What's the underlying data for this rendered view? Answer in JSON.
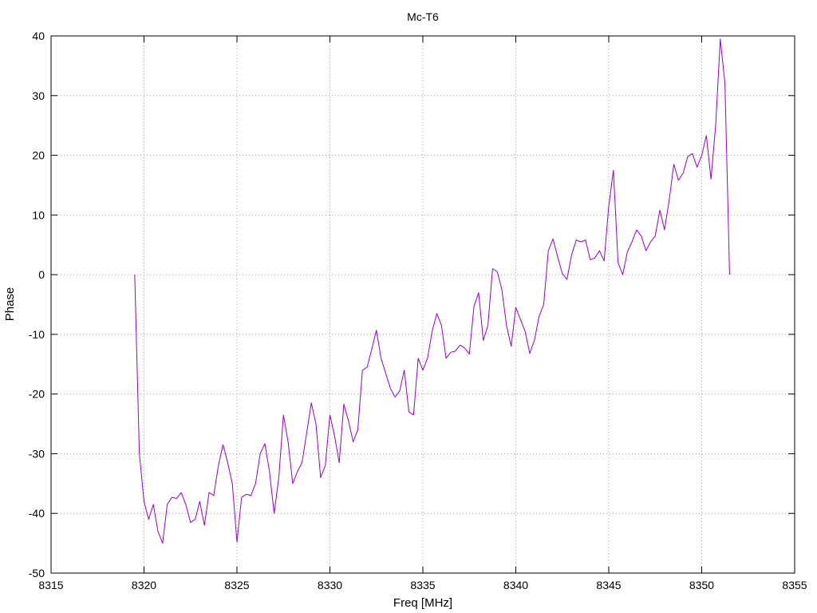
{
  "chart_data": {
    "type": "line",
    "title": "Mc-T6",
    "xlabel": "Freq [MHz]",
    "ylabel": "Phase",
    "xlim": [
      8315,
      8355
    ],
    "ylim": [
      -50,
      40
    ],
    "xticks": [
      8315,
      8320,
      8325,
      8330,
      8335,
      8340,
      8345,
      8350,
      8355
    ],
    "yticks": [
      -50,
      -40,
      -30,
      -20,
      -10,
      0,
      10,
      20,
      30,
      40
    ],
    "grid": true,
    "legend": "none",
    "line_color": "#9400d3",
    "series": [
      {
        "x": [
          8319.5,
          8319.75,
          8320,
          8320.25,
          8320.5,
          8320.75,
          8321,
          8321.25,
          8321.5,
          8321.75,
          8322,
          8322.25,
          8322.5,
          8322.75,
          8323,
          8323.25,
          8323.5,
          8323.75,
          8324,
          8324.25,
          8324.5,
          8324.75,
          8325,
          8325.25,
          8325.5,
          8325.75,
          8326,
          8326.25,
          8326.5,
          8326.75,
          8327,
          8327.25,
          8327.5,
          8327.75,
          8328,
          8328.25,
          8328.5,
          8328.75,
          8329,
          8329.25,
          8329.5,
          8329.75,
          8330,
          8330.25,
          8330.5,
          8330.75,
          8331,
          8331.25,
          8331.5,
          8331.75,
          8332,
          8332.25,
          8332.5,
          8332.75,
          8333,
          8333.25,
          8333.5,
          8333.75,
          8334,
          8334.25,
          8334.5,
          8334.75,
          8335,
          8335.25,
          8335.5,
          8335.75,
          8336,
          8336.25,
          8336.5,
          8336.75,
          8337,
          8337.25,
          8337.5,
          8337.75,
          8338,
          8338.25,
          8338.5,
          8338.75,
          8339,
          8339.25,
          8339.5,
          8339.75,
          8340,
          8340.25,
          8340.5,
          8340.75,
          8341,
          8341.25,
          8341.5,
          8341.75,
          8342,
          8342.25,
          8342.5,
          8342.75,
          8343,
          8343.25,
          8343.5,
          8343.75,
          8344,
          8344.25,
          8344.5,
          8344.75,
          8345,
          8345.25,
          8345.5,
          8345.75,
          8346,
          8346.25,
          8346.5,
          8346.75,
          8347,
          8347.25,
          8347.5,
          8347.75,
          8348,
          8348.25,
          8348.5,
          8348.75,
          8349,
          8349.25,
          8349.5,
          8349.75,
          8350,
          8350.25,
          8350.5,
          8350.75,
          8351,
          8351.25,
          8351.5
        ],
        "y": [
          0,
          -30,
          -38,
          -41,
          -38.5,
          -43,
          -45,
          -38.5,
          -37.3,
          -37.5,
          -36.5,
          -38.5,
          -41.5,
          -41,
          -38,
          -42,
          -36.5,
          -37,
          -32,
          -28.5,
          -31.5,
          -35,
          -44.8,
          -37.3,
          -36.8,
          -37,
          -35,
          -30,
          -28.3,
          -33,
          -40,
          -34,
          -23.5,
          -28,
          -35,
          -33,
          -31.5,
          -26.5,
          -21.5,
          -25,
          -34,
          -32,
          -23.5,
          -27,
          -31.5,
          -21.7,
          -24.5,
          -28,
          -26,
          -16,
          -15.5,
          -12.5,
          -9.3,
          -14,
          -16.5,
          -19,
          -20.5,
          -19.5,
          -16,
          -23,
          -23.5,
          -14,
          -16,
          -14,
          -9.5,
          -6.5,
          -8.5,
          -14,
          -13,
          -12.8,
          -11.8,
          -12.3,
          -13.3,
          -5.3,
          -3,
          -11,
          -8.5,
          1,
          0.5,
          -2.5,
          -8.5,
          -12,
          -5.5,
          -7.5,
          -9.5,
          -13.2,
          -11,
          -7,
          -5,
          4,
          6,
          3,
          0.2,
          -0.8,
          3.3,
          5.8,
          5.5,
          5.8,
          2.5,
          2.8,
          4,
          2.3,
          11.5,
          17.5,
          2,
          0,
          3.8,
          5.5,
          7.5,
          6.5,
          4,
          5.5,
          6.5,
          10.8,
          7.5,
          12.5,
          18.5,
          15.8,
          17,
          19.8,
          20.3,
          18,
          20,
          23.3,
          16,
          25,
          39.5,
          32,
          0
        ]
      }
    ]
  }
}
